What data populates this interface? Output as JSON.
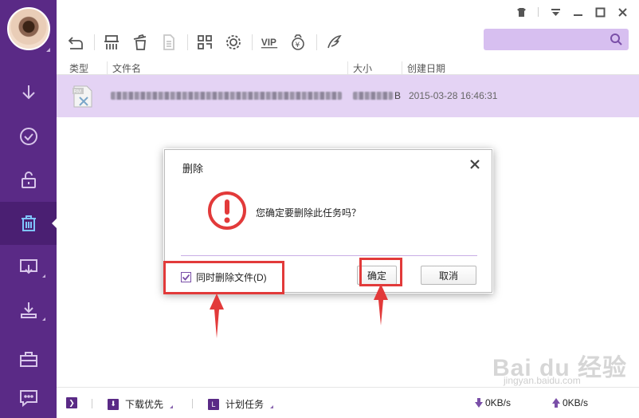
{
  "table": {
    "headers": [
      "类型",
      "文件名",
      "大小",
      "创建日期"
    ],
    "rows": [
      {
        "type_icon": "rm-file-icon",
        "name": "",
        "size_unit": "B",
        "date": "2015-03-28 16:46:31"
      }
    ]
  },
  "search": {
    "placeholder": ""
  },
  "dialog": {
    "title": "删除",
    "message": "您确定要删除此任务吗？",
    "checkbox_label": "同时删除文件(D)",
    "checkbox_checked": true,
    "ok_label": "确定",
    "cancel_label": "取消"
  },
  "statusbar": {
    "download_priority": "下载优先",
    "scheduled_task": "计划任务",
    "download_speed": "0KB/s",
    "upload_speed": "0KB/s"
  },
  "watermark": {
    "text": "Bai du 经验",
    "sub": "jingyan.baidu.com"
  },
  "colors": {
    "sidebar": "#5a2a86",
    "accent": "#7a4fa8",
    "selected_row": "#e4d3f4",
    "warning": "#e23a3a"
  }
}
